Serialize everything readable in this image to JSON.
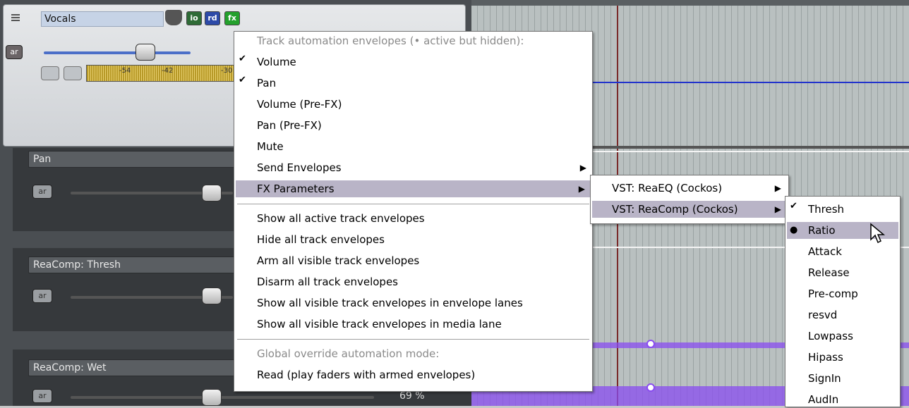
{
  "track": {
    "name": "Vocals",
    "buttons": {
      "io": "io",
      "rd": "rd",
      "fx": "fx",
      "ar": "ar"
    },
    "meter_ticks": [
      "-54",
      "-42",
      "-30"
    ]
  },
  "lanes": [
    {
      "label": "Pan",
      "ar": "ar",
      "value": ""
    },
    {
      "label": "ReaComp: Thresh",
      "ar": "ar",
      "value": ""
    },
    {
      "label": "ReaComp: Wet",
      "ar": "ar",
      "value": "69 %"
    }
  ],
  "menu": {
    "header": "Track automation envelopes (• active but hidden):",
    "items": [
      {
        "label": "Volume",
        "checked": true
      },
      {
        "label": "Pan",
        "checked": true
      },
      {
        "label": "Volume (Pre-FX)"
      },
      {
        "label": "Pan (Pre-FX)"
      },
      {
        "label": "Mute"
      },
      {
        "label": "Send Envelopes",
        "submenu": true
      },
      {
        "label": "FX Parameters",
        "submenu": true,
        "highlighted": true
      }
    ],
    "actions": [
      "Show all active track envelopes",
      "Hide all track envelopes",
      "Arm all visible track envelopes",
      "Disarm all track envelopes",
      "Show all visible track envelopes in envelope lanes",
      "Show all visible track envelopes in media lane"
    ],
    "global_header": "Global override automation mode:",
    "global_item": "Read (play faders with armed envelopes)"
  },
  "fx_submenu": [
    {
      "label": "VST: ReaEQ (Cockos)"
    },
    {
      "label": "VST: ReaComp (Cockos)",
      "highlighted": true
    }
  ],
  "param_submenu": [
    {
      "label": "Thresh",
      "mark": "✔"
    },
    {
      "label": "Ratio",
      "mark": "●",
      "highlighted": true
    },
    {
      "label": "Attack"
    },
    {
      "label": "Release"
    },
    {
      "label": "Pre-comp"
    },
    {
      "label": "resvd"
    },
    {
      "label": "Lowpass"
    },
    {
      "label": "Hipass"
    },
    {
      "label": "SignIn"
    },
    {
      "label": "AudIn"
    }
  ],
  "colors": {
    "accent_blue": "#2233cc",
    "envelope_purple": "#8a4cf0",
    "menu_highlight": "#b9b4c7"
  }
}
